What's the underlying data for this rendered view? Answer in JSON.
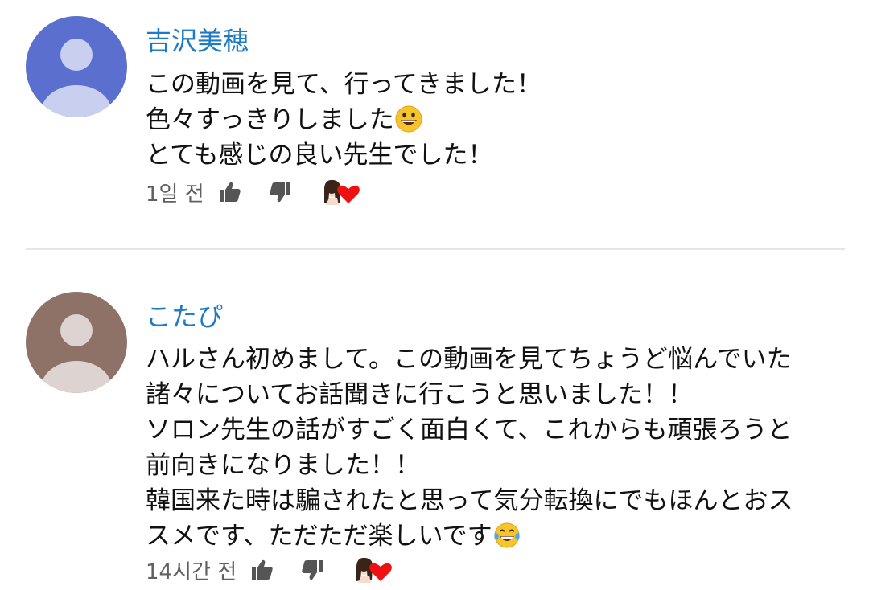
{
  "colors": {
    "author": "#1e7ac4",
    "text": "#111111",
    "meta": "#606060",
    "heart": "#ee1111",
    "avatar_blue": "#5a6fce",
    "avatar_brown": "#8f7267",
    "divider": "#e6e6e6"
  },
  "comments": [
    {
      "author": "吉沢美穂",
      "lines": [
        "この動画を見て、行ってきました！",
        "色々すっきりしました",
        "とても感じの良い先生でした！"
      ],
      "emoji_line_1": "grinning-face-emoji",
      "timestamp": "1일 전",
      "icons": [
        "thumbs-up-icon",
        "thumbs-down-icon",
        "creator-heart-icon"
      ]
    },
    {
      "author": "こたぴ",
      "lines": [
        "ハルさん初めまして。この動画を見てちょうど悩んでいた",
        "諸々についてお話聞きに行こうと思いました！！",
        "ソロン先生の話がすごく面白くて、これからも頑張ろうと",
        "前向きになりました！！",
        "韓国来た時は騙されたと思って気分転換にでもほんとおス",
        "スメです、ただただ楽しいです"
      ],
      "emoji_line_5": "tears-of-joy-emoji",
      "timestamp": "14시간 전",
      "icons": [
        "thumbs-up-icon",
        "thumbs-down-icon",
        "creator-heart-icon"
      ]
    }
  ]
}
